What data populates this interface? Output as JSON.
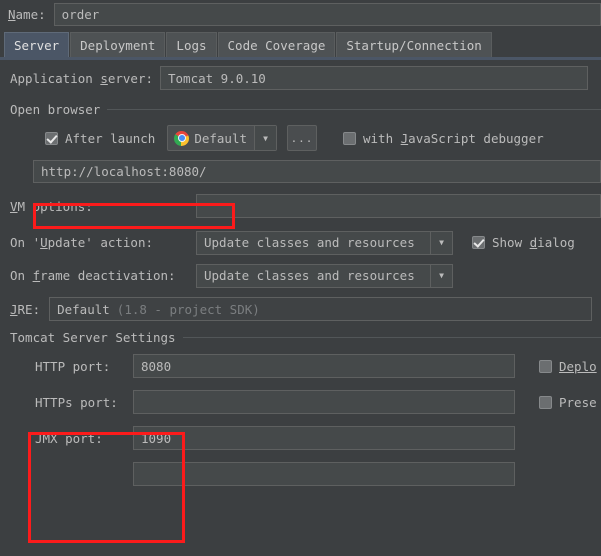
{
  "name_row": {
    "label": "Name:",
    "mnemonic": "N",
    "value": "order"
  },
  "tabs": [
    {
      "label": "Server",
      "active": true
    },
    {
      "label": "Deployment",
      "active": false
    },
    {
      "label": "Logs",
      "active": false
    },
    {
      "label": "Code Coverage",
      "active": false
    },
    {
      "label": "Startup/Connection",
      "active": false
    }
  ],
  "application_server": {
    "label": "Application server:",
    "value": "Tomcat 9.0.10"
  },
  "open_browser": {
    "section_title": "Open browser",
    "after_launch": {
      "label": "After launch",
      "checked": true
    },
    "browser": {
      "value": "Default",
      "icon": "chrome-icon",
      "arrow": "▼"
    },
    "more_button": "...",
    "js_debugger": {
      "label": "with JavaScript debugger",
      "checked": false
    },
    "url": "http://localhost:8080/"
  },
  "vm_options": {
    "label": "VM options:",
    "value": ""
  },
  "on_update": {
    "label": "On 'Update' action:",
    "value": "Update classes and resources",
    "arrow": "▼",
    "show_dialog": {
      "label": "Show dialog",
      "checked": true
    }
  },
  "on_frame_deactivation": {
    "label": "On frame deactivation:",
    "value": "Update classes and resources",
    "arrow": "▼"
  },
  "jre": {
    "label": "JRE:",
    "value": "Default",
    "hint": "(1.8 - project SDK)"
  },
  "tomcat_settings": {
    "section_title": "Tomcat Server Settings",
    "ports": [
      {
        "label": "HTTP port:",
        "value": "8080"
      },
      {
        "label": "HTTPs port:",
        "value": ""
      },
      {
        "label": "JMX port:",
        "value": "1090"
      }
    ],
    "right_checkboxes": [
      {
        "label": "Deplo",
        "checked": false
      },
      {
        "label": "Prese",
        "checked": false
      }
    ]
  },
  "highlights": [
    {
      "name": "url-highlight"
    },
    {
      "name": "ports-highlight"
    }
  ],
  "colors": {
    "background": "#3c3f41",
    "field_background": "#45494a",
    "active_tab": "#4b5666",
    "highlight_red": "#fc1b1b",
    "text": "#bbbbbb"
  }
}
